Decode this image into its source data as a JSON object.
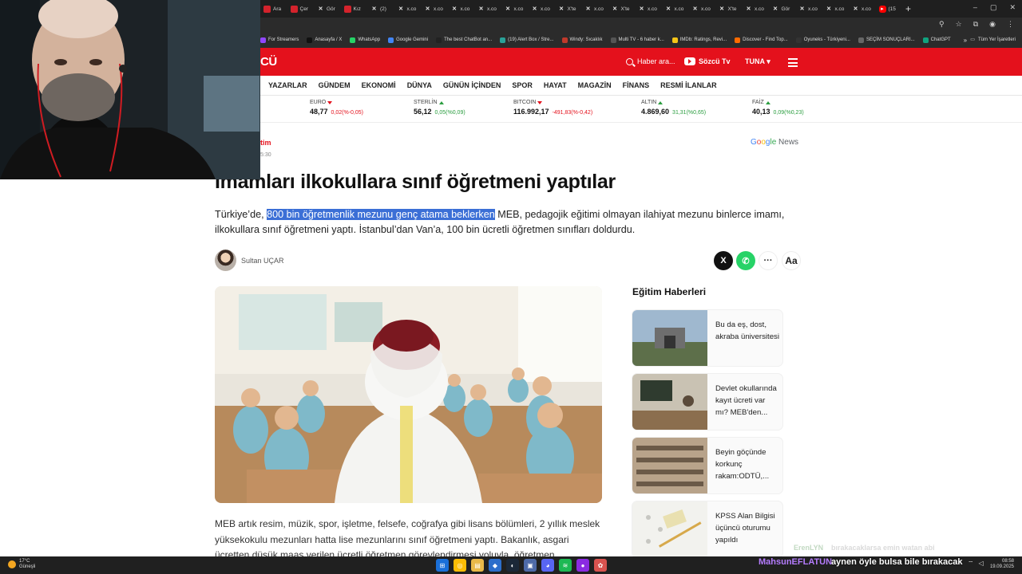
{
  "browser": {
    "tabs": [
      "Ara",
      "Çer",
      "Gör",
      "Kız",
      "(2)",
      "x.co",
      "x.co",
      "x.co",
      "x.co",
      "x.co",
      "x.co",
      "X'te",
      "x.co",
      "X'te",
      "x.co",
      "x.co",
      "x.co",
      "X'te",
      "x.co",
      "Gör",
      "x.co",
      "x.co",
      "x.co",
      "(15"
    ],
    "bookmarks": [
      "For Streamers",
      "Anasayfa / X",
      "WhatsApp",
      "Google Gemini",
      "The best ChatBot an...",
      "(19) Alert Box / Stre...",
      "Windy: Sıcaklık",
      "Multi TV - 6 haber k...",
      "IMDb: Ratings, Revi...",
      "Discover - Find Top...",
      "Oyuneks - Türkiyeni...",
      "SEÇİM SONUÇLARI...",
      "ChatGPT"
    ],
    "bookmarks_folder": "Tüm Yer İşaretleri"
  },
  "site": {
    "logo": "CÜ",
    "search_placeholder": "Haber ara...",
    "tv_label": "Sözcü Tv",
    "user_label": "TUNA",
    "nav": [
      "YAZARLAR",
      "GÜNDEM",
      "EKONOMİ",
      "DÜNYA",
      "GÜNÜN İÇİNDEN",
      "SPOR",
      "HAYAT",
      "MAGAZİN",
      "FİNANS",
      "RESMİ İLANLAR"
    ],
    "ticker": [
      {
        "name": "EURO",
        "dir": "down",
        "value": "48,77",
        "change": "0,02(%-0,05)"
      },
      {
        "name": "STERLİN",
        "dir": "up",
        "value": "56,12",
        "change": "0,05(%0,09)"
      },
      {
        "name": "BITCOIN",
        "dir": "down",
        "value": "116.992,17",
        "change": "-491,83(%-0,42)"
      },
      {
        "name": "ALTIN",
        "dir": "up",
        "value": "4.869,60",
        "change": "31,31(%0,65)"
      },
      {
        "name": "FAİZ",
        "dir": "up",
        "value": "40,13",
        "change": "0,09(%0,23)"
      }
    ]
  },
  "article": {
    "category": "tim",
    "time": "5:30",
    "google_news": [
      "G",
      "o",
      "o",
      "g",
      "le",
      " News"
    ],
    "headline": "İmamları ilkokullara sınıf öğretmeni yaptılar",
    "lead_before": "Türkiye’de, ",
    "lead_highlight": "800 bin öğretmenlik mezunu genç atama beklerken",
    "lead_after": " MEB, pedagojik eğitimi olmayan ilahiyat mezunu binlerce imamı, ilkokullara sınıf öğretmeni yaptı. İstanbul’dan Van’a, 100 bin ücretli öğretmen sınıfları doldurdu.",
    "author": "Sultan UÇAR",
    "share_x": "X",
    "share_wa": "✆",
    "share_more": "···",
    "share_font": "Aa",
    "body": "MEB artık resim, müzik, spor, işletme, felsefe, coğrafya gibi lisans bölümleri, 2 yıllık meslek yüksekokulu mezunları hatta lise mezunlarını sınıf öğretmeni yaptı. Bakanlık, asgari ücretten düşük maaş verilen ücretli öğretmen görevlendirmesi yoluyla, öğretmen"
  },
  "sidebar": {
    "title": "Eğitim Haberleri",
    "items": [
      {
        "title": "Bu da eş, dost, akraba üniversitesi"
      },
      {
        "title": "Devlet okullarında kayıt ücreti var mı? MEB'den..."
      },
      {
        "title": "Beyin göçünde korkunç rakam:ODTÜ,..."
      },
      {
        "title": "KPSS Alan Bilgisi üçüncü oturumu yapıldı"
      }
    ]
  },
  "taskbar": {
    "temp": "17°C",
    "weather": "Güneşli",
    "time": "08:58",
    "date": "19.09.2025"
  },
  "stream": {
    "chat_user": "MahsunEFLATUN",
    "chat_message": "aynen öyle bulsa bile bırakacak",
    "ghost_user": "ErenLYN",
    "ghost_message": "bırakacaklarsa emin watan abi"
  },
  "colors": {
    "brand": "#e4111c",
    "highlight": "#3b6fd6",
    "up": "#2a9d3f",
    "down": "#e4111c"
  }
}
